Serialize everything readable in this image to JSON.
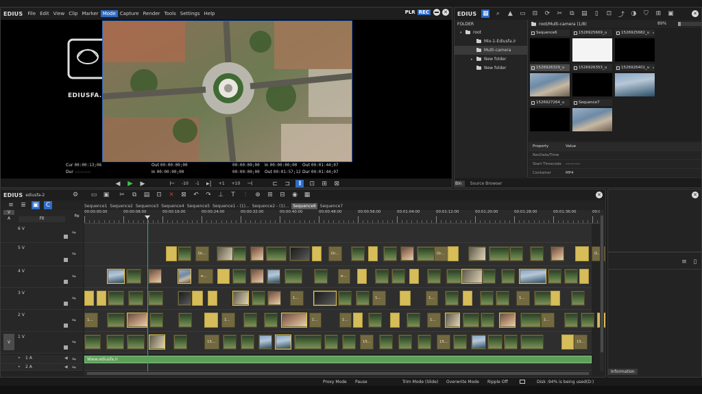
{
  "app": {
    "brand": "EDIUS",
    "logo_text": "EDIUSFA.IR",
    "watermark": "Www.ediusfa.ir"
  },
  "menu": [
    "File",
    "Edit",
    "View",
    "Clip",
    "Marker",
    "Mode",
    "Capture",
    "Render",
    "Tools",
    "Settings",
    "Help"
  ],
  "menu_active": "Mode",
  "player": {
    "plr": "PLR",
    "rec": "REC",
    "cur_label": "Cur",
    "cur_value": "00:00:13;06",
    "dur_label": "Dur",
    "dur_value": "--:--:--:--",
    "out_label": "Out",
    "out_value": "00:00:00;00",
    "in_label": "In",
    "in_value": "00:00:00;00",
    "dur2_value": "00:00:00;00",
    "in2_value": "00:00:00;00",
    "out_value_right": "00:01:44;07",
    "in_value_right": "00:00:00;00",
    "out_value_right2": "00:01:57;12",
    "dur_value_right": "00:01:44;07",
    "transport": [
      "-10",
      "-1",
      "+1",
      "+10"
    ]
  },
  "bin": {
    "title": "EDIUS",
    "zoom": "89%",
    "folder_label": "FOLDER",
    "path": "root/Multi-camera (1/8)",
    "tree": [
      {
        "label": "root",
        "indent": 0,
        "selected": false
      },
      {
        "label": "Mix-1-Ediusfa.ir",
        "indent": 1,
        "selected": false
      },
      {
        "label": "Multi-camera",
        "indent": 1,
        "selected": true
      },
      {
        "label": "New folder",
        "indent": 1,
        "selected": false
      },
      {
        "label": "New folder",
        "indent": 1,
        "selected": false
      }
    ],
    "clips": [
      {
        "name": "Sequence6",
        "thumb": "f"
      },
      {
        "name": "1526925669_u",
        "thumb": "white"
      },
      {
        "name": "1526925682_u",
        "thumb": "f"
      },
      {
        "name": "1526926329_u",
        "thumb": "b"
      },
      {
        "name": "1526926353_u",
        "thumb": "f"
      },
      {
        "name": "1526926401_u",
        "thumb": "e"
      },
      {
        "name": "1526927264_u",
        "thumb": "f"
      },
      {
        "name": "Sequence7",
        "thumb": "b"
      }
    ],
    "property_header": "Property",
    "value_header": "Value",
    "properties": [
      {
        "name": "RecDate/Time",
        "value": ""
      },
      {
        "name": "Start Timecode",
        "value": "--:--:--:--"
      },
      {
        "name": "Container",
        "value": "MP4"
      }
    ],
    "bottom_tabs": [
      "Bin",
      "Source Browser"
    ]
  },
  "timeline": {
    "brand": "EDIUS",
    "project": "ediusfa-2",
    "fit_label": "Fit",
    "sequences": [
      "Sequence1",
      "Sequence2",
      "Sequence3",
      "Sequence4",
      "Sequence5",
      "Sequence1 - (1)...",
      "Sequence2 - (1)...",
      "Sequence6",
      "Sequence7"
    ],
    "active_sequence": "Sequence6",
    "ruler": [
      "00:00:00:00",
      "00:00:08:00",
      "00:00:16:00",
      "00:00:24:00",
      "00:00:32:00",
      "00:00:40:00",
      "00:00:48:00",
      "00:00:56:00",
      "00:01:04:00",
      "00:01:12:00",
      "00:01:20:00",
      "00:01:28:00",
      "00:01:36:00",
      "00:0"
    ],
    "tracks": [
      {
        "name": "6 V"
      },
      {
        "name": "5 V"
      },
      {
        "name": "4 V"
      },
      {
        "name": "3 V"
      },
      {
        "name": "2 V"
      },
      {
        "name": "1 V"
      },
      {
        "name": "1 A"
      },
      {
        "name": "2 A"
      }
    ],
    "clip_labels": {
      "dr": "Dr...",
      "d": "D...",
      "e": "e...",
      "one": "1...",
      "fifteen": "15...",
      "sample": "..."
    },
    "v_label": "V",
    "a_label": "A"
  },
  "status": [
    "Proxy Mode",
    "Pause",
    "Trim Mode (Slide)",
    "Overwrite Mode",
    "Ripple Off",
    "Disk :94% is being used(D:)"
  ],
  "info_tab": "Information",
  "colors": {
    "accent": "#2e6bc6",
    "rec": "#2e6bc6",
    "clip": "#736940",
    "title_clip": "#d6bd5a",
    "audio": "#5f9e5a",
    "playhead": "#2aa7a7"
  }
}
